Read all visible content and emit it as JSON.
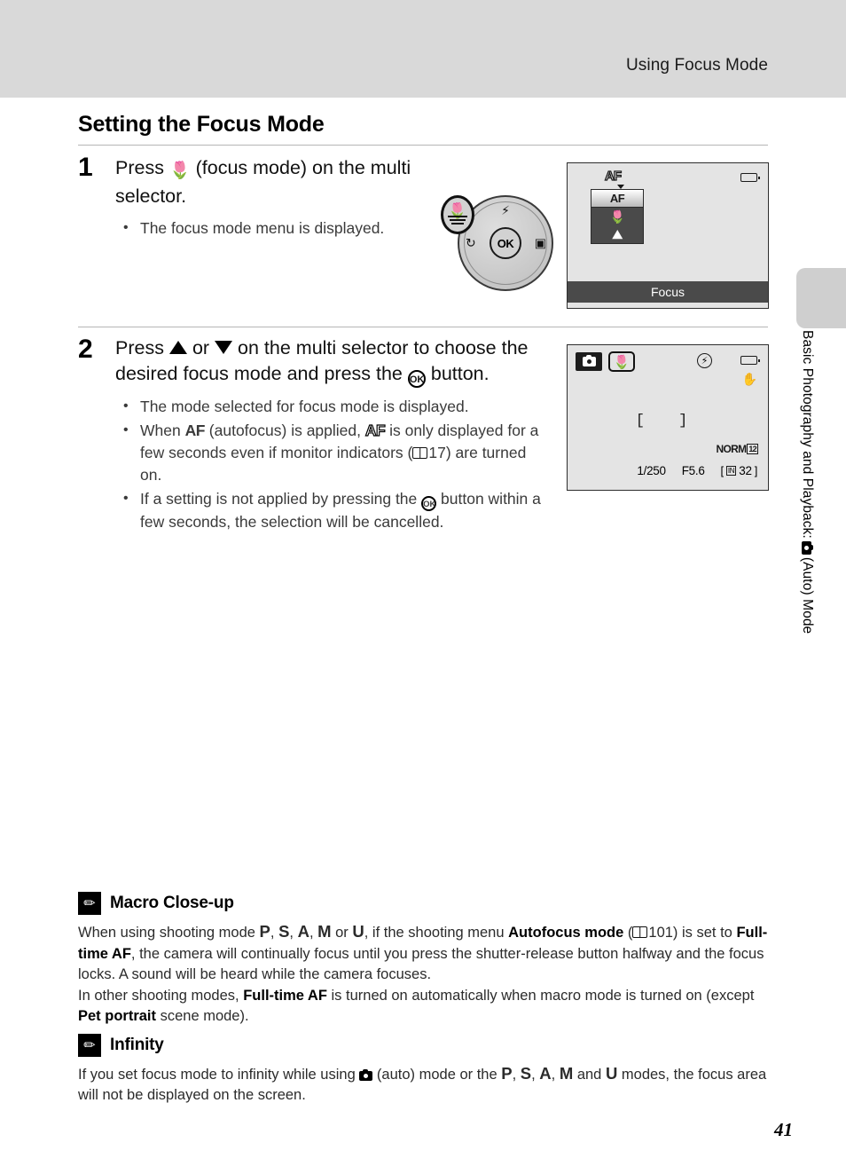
{
  "header": {
    "title": "Using Focus Mode"
  },
  "side_tab": {
    "text_before": "Basic Photography and Playback:",
    "icon": "camera-auto-icon",
    "text_after": "(Auto) Mode"
  },
  "section": {
    "title": "Setting the Focus Mode"
  },
  "steps": [
    {
      "number": "1",
      "text_parts": {
        "a": "Press",
        "icon": "macro-flower-icon",
        "b": "(focus mode) on the multi selector."
      },
      "bullets": [
        "The focus mode menu is displayed."
      ]
    },
    {
      "number": "2",
      "text_parts": {
        "a": "Press",
        "icon_up": "triangle-up-icon",
        "b": "or",
        "icon_down": "triangle-down-icon",
        "c": "on the multi selector to choose the desired focus mode and press the",
        "icon_ok": "ok-button-icon",
        "d": "button."
      },
      "bullets": [
        "The mode selected for focus mode is displayed.",
        "When AF (autofocus) is applied, AF is only displayed for a few seconds even if monitor indicators (17) are turned on.",
        "If a setting is not applied by pressing the OK button within a few seconds, the selection will be cancelled."
      ],
      "bullet2_parts": {
        "a": "When",
        "af1": "AF",
        "b": "(autofocus) is applied,",
        "af2": "AF",
        "c": "is only displayed for a few seconds even if monitor indicators (",
        "page_ref": "17",
        "d": ") are turned on."
      },
      "bullet3_parts": {
        "a": "If a setting is not applied by pressing the",
        "ok": "OK",
        "b": "button within a few seconds, the selection will be cancelled."
      }
    }
  ],
  "dial": {
    "ok_label": "OK",
    "top_icon": "flash-icon",
    "left_icon": "self-timer-icon",
    "right_icon": "exposure-compensation-icon",
    "bottom_icon": "macro-flower-icon"
  },
  "monitor1": {
    "af_indicator": "AF",
    "menu_items": [
      {
        "label": "AF",
        "icon": "",
        "selected": true
      },
      {
        "label": "",
        "icon": "macro-flower-icon",
        "selected": false
      },
      {
        "label": "",
        "icon": "infinity-mountain-icon",
        "selected": false
      }
    ],
    "battery_icon": "battery-icon",
    "bottom_label": "Focus"
  },
  "monitor2": {
    "mode_icon": "camera-auto-icon",
    "focus_mode_icon": "macro-flower-icon",
    "flash_off_icon": "flash-off-icon",
    "battery_icon": "battery-icon",
    "vr_icon": "vibration-reduction-icon",
    "focus_area": "[    ]",
    "quality": "NORM",
    "image_size_icon": "image-size-icon",
    "shutter_speed": "1/250",
    "aperture": "F5.6",
    "shots_remaining": "32",
    "card_icon": "internal-memory-icon"
  },
  "notes": [
    {
      "icon": "pencil-note-icon",
      "title": "Macro Close-up",
      "paragraphs": [
        {
          "a": "When using shooting mode ",
          "modes1": [
            "P",
            "S",
            "A",
            "M"
          ],
          "b": " or ",
          "mode_u": "U",
          "c": ", if the shooting menu ",
          "bold1": "Autofocus mode",
          "d": " (",
          "page_ref": "101",
          "e": ") is set to ",
          "bold2": "Full-time AF",
          "f": ", the camera will continually focus until you press the shutter-release button halfway and the focus locks. A sound will be heard while the camera focuses."
        },
        {
          "a": "In other shooting modes, ",
          "bold1": "Full-time AF",
          "b": " is turned on automatically when macro mode is turned on (except ",
          "bold2": "Pet portrait",
          "c": " scene mode)."
        }
      ]
    },
    {
      "icon": "pencil-note-icon",
      "title": "Infinity",
      "paragraphs": [
        {
          "a": "If you set focus mode to infinity while using ",
          "icon": "camera-auto-icon",
          "b": " (auto) mode or the ",
          "modes1": [
            "P",
            "S",
            "A",
            "M"
          ],
          "c": " and ",
          "mode_u": "U",
          "d": " modes, the focus area will not be displayed on the screen."
        }
      ]
    }
  ],
  "page_number": "41"
}
